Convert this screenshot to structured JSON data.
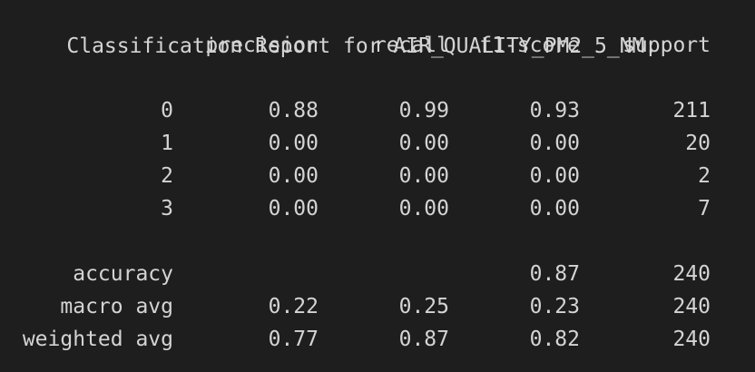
{
  "title": "Classification Report for AIR_QUALITY_PM2_5_NM:",
  "headers": [
    "precision",
    "recall",
    "f1-score",
    "support"
  ],
  "rows": [
    {
      "label": "0",
      "precision": "0.88",
      "recall": "0.99",
      "f1": "0.93",
      "support": "211"
    },
    {
      "label": "1",
      "precision": "0.00",
      "recall": "0.00",
      "f1": "0.00",
      "support": "20"
    },
    {
      "label": "2",
      "precision": "0.00",
      "recall": "0.00",
      "f1": "0.00",
      "support": "2"
    },
    {
      "label": "3",
      "precision": "0.00",
      "recall": "0.00",
      "f1": "0.00",
      "support": "7"
    }
  ],
  "summary": [
    {
      "label": "accuracy",
      "precision": "",
      "recall": "",
      "f1": "0.87",
      "support": "240"
    },
    {
      "label": "macro avg",
      "precision": "0.22",
      "recall": "0.25",
      "f1": "0.23",
      "support": "240"
    },
    {
      "label": "weighted avg",
      "precision": "0.77",
      "recall": "0.87",
      "f1": "0.82",
      "support": "240"
    }
  ],
  "colors": {
    "background": "#1e1e1e",
    "text": "#d4d4d4"
  }
}
